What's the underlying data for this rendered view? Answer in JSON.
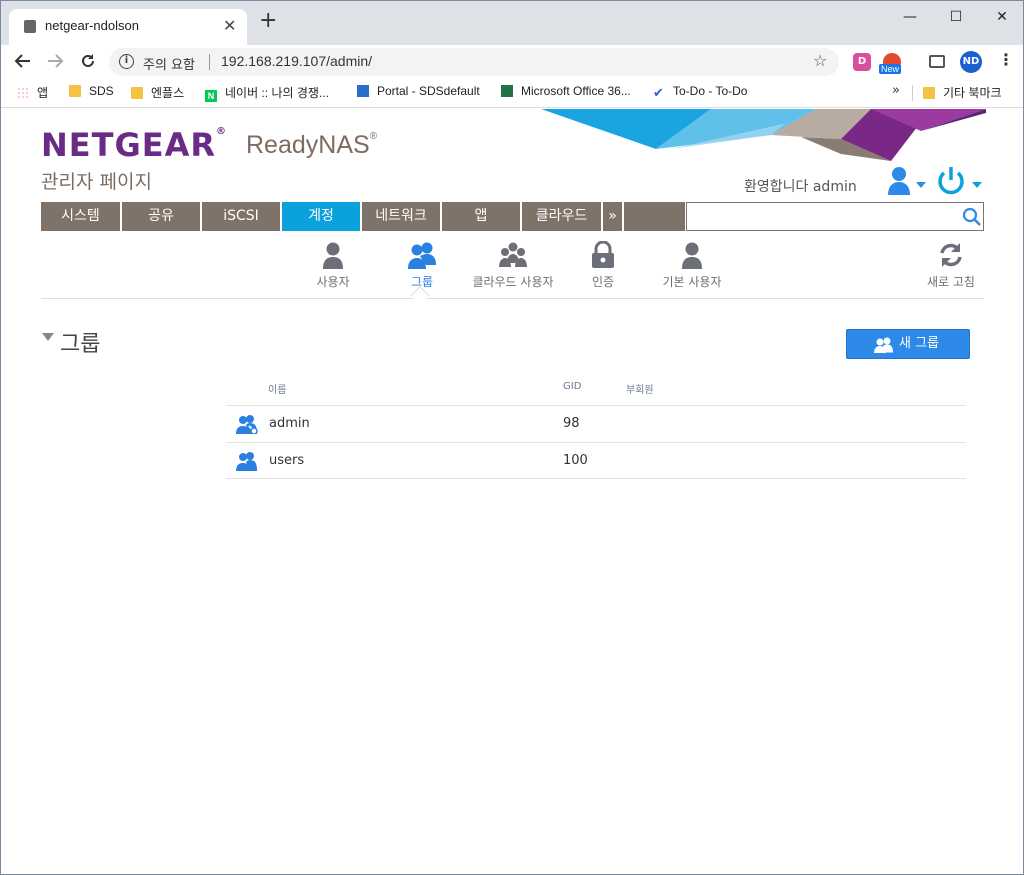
{
  "browser": {
    "tab_title": "netgear-ndolson",
    "close_glyph": "✕",
    "newtab_glyph": "+",
    "win_minimize": "—",
    "win_maximize": "☐",
    "win_close": "✕",
    "security_label": "주의 요함",
    "url": "192.168.219.107/admin/",
    "ext_d_label": "D",
    "ext_new_badge": "New",
    "profile_initials": "ND",
    "bookmarks": [
      {
        "label": "앱",
        "icon": "apps-icon"
      },
      {
        "label": "SDS",
        "icon": "folder-icon"
      },
      {
        "label": "엔플스",
        "icon": "folder-icon"
      },
      {
        "label": "네이버 :: 나의 경쟁...",
        "icon": "naver-icon"
      },
      {
        "label": "Portal - SDSdefault",
        "icon": "portal-icon"
      },
      {
        "label": "Microsoft Office 36...",
        "icon": "office-icon"
      },
      {
        "label": "To-Do - To-Do",
        "icon": "todo-icon"
      }
    ],
    "bookmarks_more": "»",
    "other_bookmarks": "기타 북마크"
  },
  "app": {
    "brand": "NETGEAR",
    "product": "ReadyNAS",
    "subtitle": "관리자 페이지",
    "welcome": "환영합니다 admin",
    "brand_colors": {
      "purple": "#6a2b87",
      "taupe": "#7f7268",
      "accent": "#0aa1dd",
      "button": "#2d8ae8"
    }
  },
  "mainnav": {
    "items": [
      {
        "label": "시스템",
        "active": false
      },
      {
        "label": "공유",
        "active": false
      },
      {
        "label": "iSCSI",
        "active": false
      },
      {
        "label": "계정",
        "active": true
      },
      {
        "label": "네트워크",
        "active": false
      },
      {
        "label": "앱",
        "active": false
      },
      {
        "label": "클라우드",
        "active": false
      }
    ],
    "more": "»",
    "search_placeholder": ""
  },
  "subnav": {
    "items": [
      {
        "label": "사용자",
        "icon": "user-icon",
        "active": false
      },
      {
        "label": "그룹",
        "icon": "group-icon",
        "active": true
      },
      {
        "label": "클라우드 사용자",
        "icon": "cloud-users-icon",
        "active": false
      },
      {
        "label": "인증",
        "icon": "lock-icon",
        "active": false
      },
      {
        "label": "기본 사용자",
        "icon": "default-user-icon",
        "active": false
      }
    ],
    "refresh": "새로 고침"
  },
  "groups": {
    "title": "그룹",
    "new_button": "새 그룹",
    "columns": [
      "이름",
      "GID",
      "부회원"
    ],
    "rows": [
      {
        "name": "admin",
        "gid": "98",
        "members": ""
      },
      {
        "name": "users",
        "gid": "100",
        "members": ""
      }
    ]
  }
}
